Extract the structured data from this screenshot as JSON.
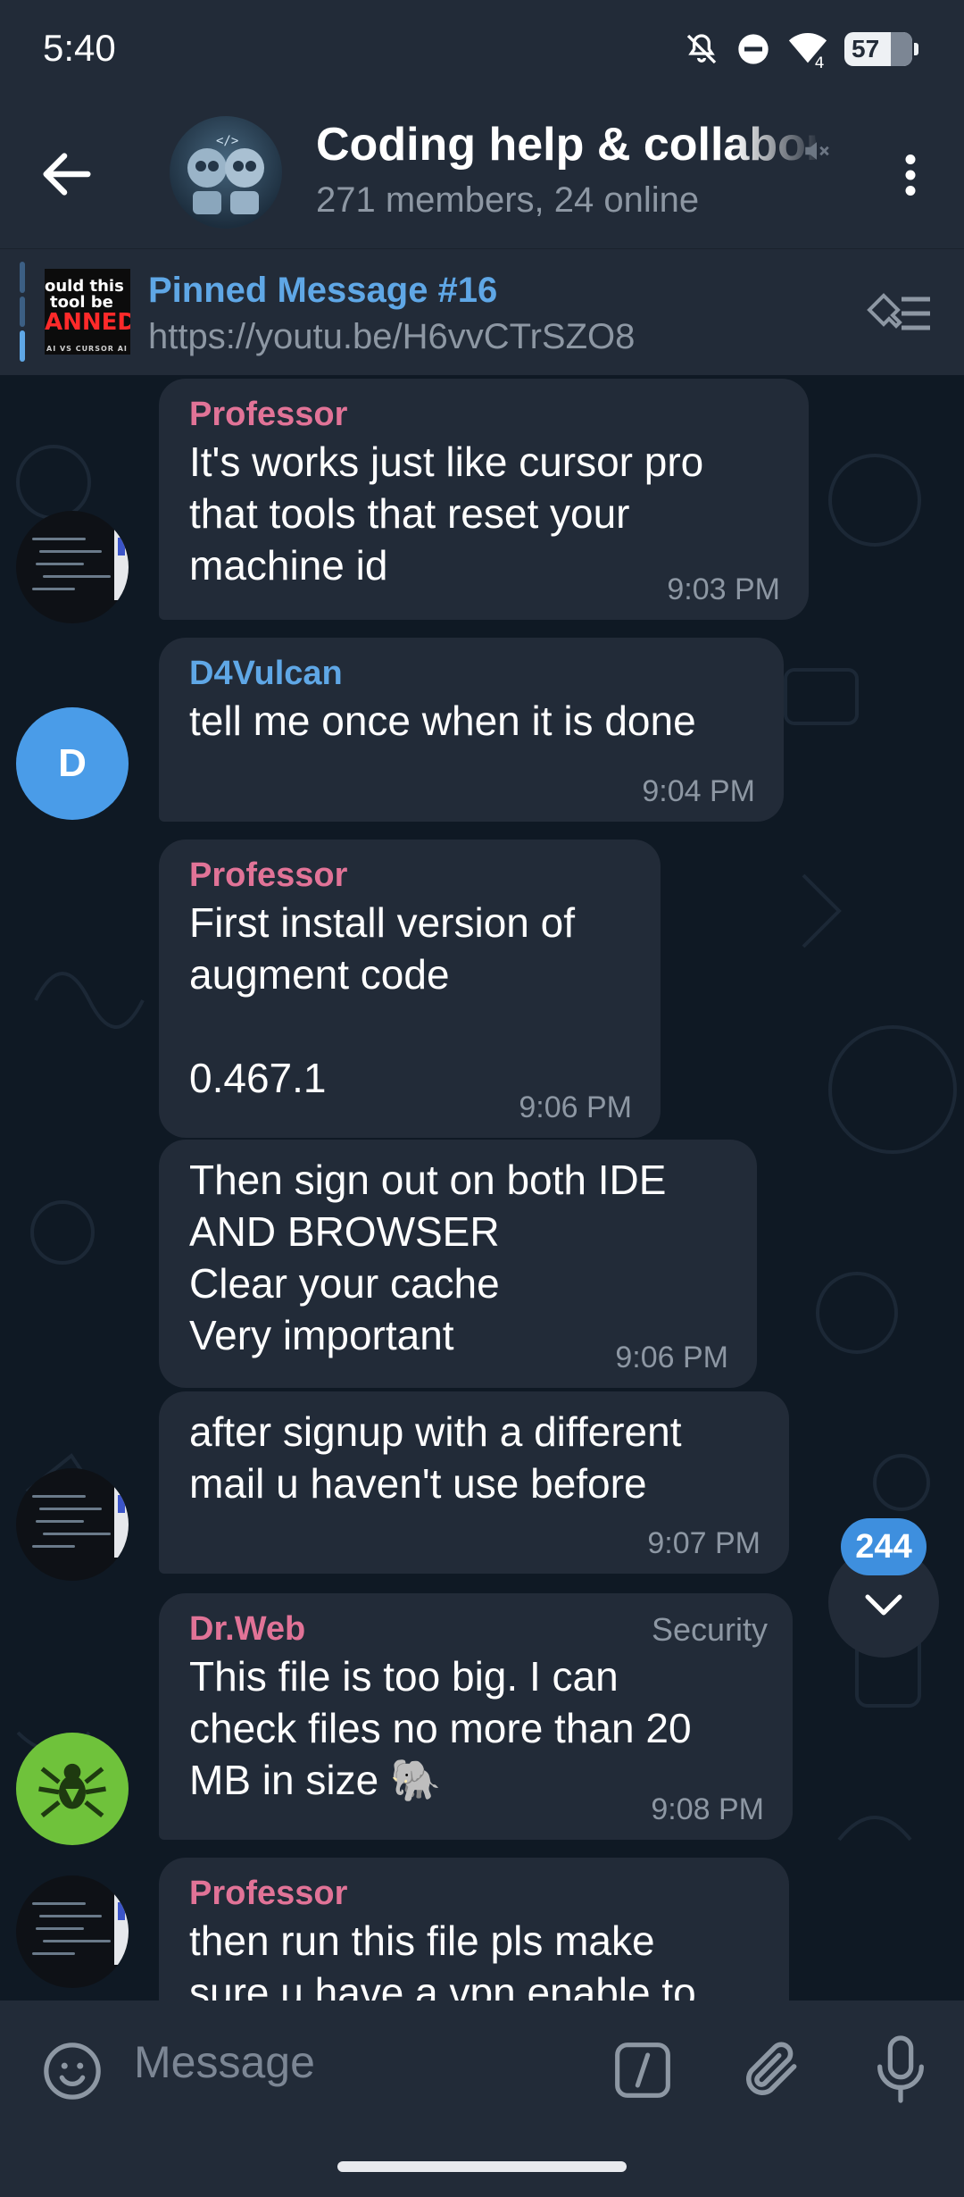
{
  "status_bar": {
    "time": "5:40",
    "battery": "57",
    "signal_label": "4",
    "icons": [
      "bell-off-icon",
      "dnd-icon",
      "wifi-icon",
      "battery-icon"
    ]
  },
  "header": {
    "title": "Coding help & collabor",
    "subtitle": "271 members, 24 online",
    "icons": [
      "back-arrow-icon",
      "muted-icon",
      "more-vertical-icon"
    ]
  },
  "pinned": {
    "title": "Pinned Message #16",
    "link": "https://youtu.be/H6vvCTrSZO8",
    "thumb_line1": "ould this",
    "thumb_line2": "tool be",
    "thumb_line3": "ANNED!!!",
    "thumb_line4": "AI VS CURSOR AI"
  },
  "messages": [
    {
      "sender": "Professor",
      "text": "It's works just like cursor pro\nthat tools that reset your\nmachine id",
      "time": "9:03 PM"
    },
    {
      "sender": "D4Vulcan",
      "avatar_letter": "D",
      "text": "tell me once when it is done",
      "time": "9:04 PM"
    },
    {
      "sender": "Professor",
      "text": "First install version of\naugment code\n\n0.467.1",
      "time": "9:06 PM"
    },
    {
      "text": "Then sign out on both IDE\nAND BROWSER\nClear your cache\nVery important",
      "time": "9:06 PM"
    },
    {
      "text": "after signup with a different\nmail u haven't use before",
      "time": "9:07 PM"
    },
    {
      "sender": "Dr.Web",
      "role": "Security",
      "text": "This file is too big. I can\ncheck files no more than 20\nMB in size 🐘",
      "time": "9:08 PM"
    },
    {
      "sender": "Professor",
      "text": "then run this file pls make\nsure u have a vpn enable to"
    }
  ],
  "scroll": {
    "unread_count": "244"
  },
  "input": {
    "placeholder": "Message",
    "icons": [
      "emoji-icon",
      "bot-command-icon",
      "attach-icon",
      "mic-icon"
    ]
  },
  "colors": {
    "background": "#0f1924",
    "bar": "#222b38",
    "bubble": "#222b38",
    "accent_blue": "#5fa7e6",
    "sender_pink": "#e17397",
    "muted_text": "#8d97a3",
    "badge": "#3e8fde"
  }
}
